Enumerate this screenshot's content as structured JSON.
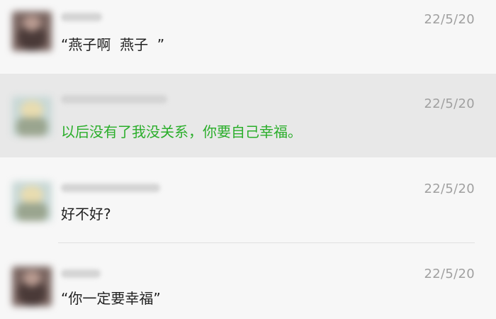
{
  "messages": [
    {
      "date": "22/5/20",
      "text": "“燕子啊  燕子  ”",
      "avatar_icon": "blurred-contact-avatar-dark",
      "selected": false
    },
    {
      "date": "22/5/20",
      "text": "以后没有了我没关系，你要自己幸福。",
      "avatar_icon": "blurred-contact-avatar-light",
      "selected": true,
      "text_color": "#2aae2a"
    },
    {
      "date": "22/5/20",
      "text": "好不好?",
      "avatar_icon": "blurred-contact-avatar-light",
      "selected": false
    },
    {
      "date": "22/5/20",
      "text": "“你一定要幸福”",
      "avatar_icon": "blurred-contact-avatar-dark",
      "selected": false
    }
  ],
  "colors": {
    "background": "#f7f7f7",
    "selected_background": "#e8e8e8",
    "date_text": "#a0a0a0",
    "message_text": "#222222",
    "highlight_text": "#2aae2a"
  }
}
